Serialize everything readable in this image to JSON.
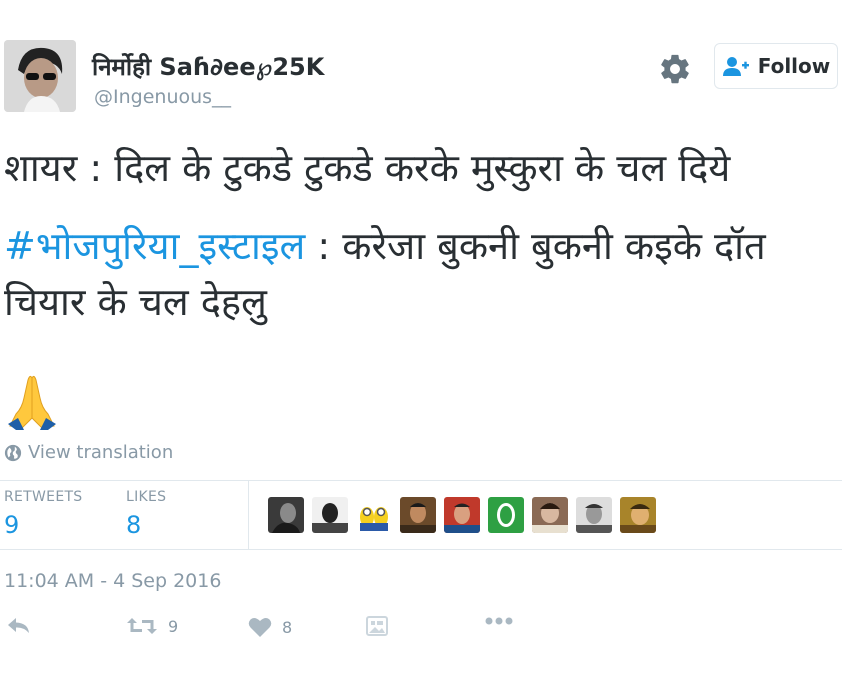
{
  "user": {
    "display_name": "निर्मोही Saɦ∂ee℘25K",
    "handle": "@Ingenuous__"
  },
  "header": {
    "follow_label": "Follow"
  },
  "tweet": {
    "line1": "शायर : दिल के  टुकडे टुकडे करके मुस्कुरा के चल दिये",
    "hashtag": "#भोजपुरिया_इस्टाइल",
    "line2_rest": " : करेजा बुकनी बुकनी कइके दॉत चियार के चल देहलु",
    "emoji_name": "folded-hands"
  },
  "translate_label": "View translation",
  "stats": {
    "retweets_label": "RETWEETS",
    "retweets_count": "9",
    "likes_label": "LIKES",
    "likes_count": "8"
  },
  "timestamp": "11:04 AM - 4 Sep 2016",
  "actions": {
    "retweet_count": "9",
    "like_count": "8"
  },
  "colors": {
    "link": "#1b95e0",
    "muted": "#8899a6",
    "text": "#292f33",
    "border": "#e1e8ed"
  }
}
